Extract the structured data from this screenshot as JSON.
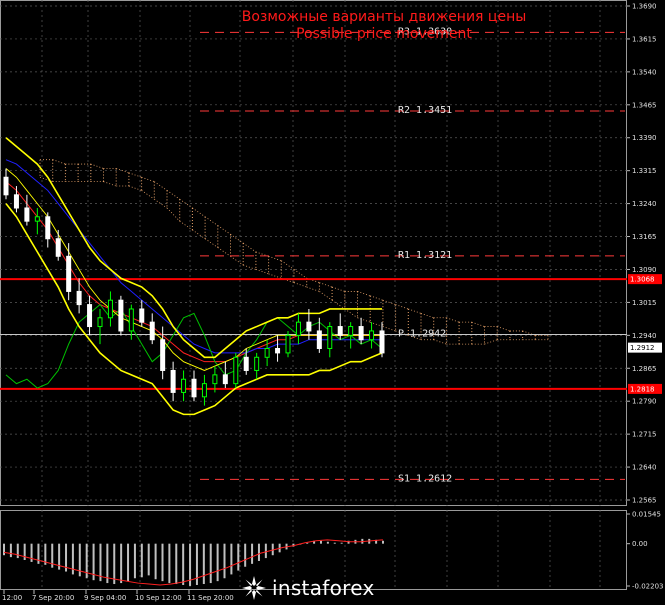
{
  "chart_data": [
    {
      "type": "candlestick",
      "title": "Возможные варианты движения цены",
      "subtitle": "Possible price movement",
      "ylim": [
        1.2565,
        1.369
      ],
      "y_ticks": [
        "1.3690",
        "1.3615",
        "1.3540",
        "1.3465",
        "1.3390",
        "1.3315",
        "1.3240",
        "1.3165",
        "1.3090",
        "1.3015",
        "1.2940",
        "1.2865",
        "1.2790",
        "1.2715",
        "1.2640",
        "1.2565"
      ],
      "x_ticks": [
        "12:00",
        "7 Sep 20:00",
        "9 Sep 04:00",
        "10 Sep 12:00",
        "11 Sep 20:00"
      ],
      "pivots": [
        {
          "label": "R3",
          "value": 1.363
        },
        {
          "label": "R2",
          "value": 1.3451
        },
        {
          "label": "R1",
          "value": 1.3121
        },
        {
          "label": "P",
          "value": 1.2942
        },
        {
          "label": "S1",
          "value": 1.2612
        }
      ],
      "horizontal_levels": [
        {
          "value": 1.3068,
          "label": "1.3068",
          "color": "#ff0000"
        },
        {
          "value": 1.2818,
          "label": "1.2818",
          "color": "#ff0000"
        },
        {
          "value": 1.2942,
          "label": "",
          "color": "#c8c8c8"
        }
      ],
      "current_price": {
        "value": 1.2912,
        "label": "1.2912"
      },
      "candles": [
        [
          1.33,
          1.332,
          1.325,
          1.326
        ],
        [
          1.326,
          1.328,
          1.322,
          1.323
        ],
        [
          1.323,
          1.326,
          1.319,
          1.32
        ],
        [
          1.32,
          1.323,
          1.317,
          1.321
        ],
        [
          1.321,
          1.322,
          1.314,
          1.316
        ],
        [
          1.316,
          1.318,
          1.311,
          1.312
        ],
        [
          1.312,
          1.315,
          1.302,
          1.304
        ],
        [
          1.304,
          1.307,
          1.299,
          1.301
        ],
        [
          1.301,
          1.303,
          1.294,
          1.296
        ],
        [
          1.296,
          1.3,
          1.292,
          1.298
        ],
        [
          1.298,
          1.304,
          1.296,
          1.302
        ],
        [
          1.302,
          1.303,
          1.294,
          1.295
        ],
        [
          1.295,
          1.301,
          1.293,
          1.3
        ],
        [
          1.3,
          1.302,
          1.296,
          1.297
        ],
        [
          1.297,
          1.299,
          1.292,
          1.293
        ],
        [
          1.293,
          1.296,
          1.284,
          1.286
        ],
        [
          1.286,
          1.288,
          1.279,
          1.281
        ],
        [
          1.281,
          1.286,
          1.279,
          1.284
        ],
        [
          1.284,
          1.286,
          1.279,
          1.28
        ],
        [
          1.28,
          1.285,
          1.278,
          1.283
        ],
        [
          1.283,
          1.287,
          1.281,
          1.285
        ],
        [
          1.285,
          1.288,
          1.282,
          1.283
        ],
        [
          1.283,
          1.29,
          1.282,
          1.289
        ],
        [
          1.289,
          1.291,
          1.285,
          1.286
        ],
        [
          1.286,
          1.29,
          1.284,
          1.289
        ],
        [
          1.289,
          1.293,
          1.287,
          1.291
        ],
        [
          1.291,
          1.294,
          1.288,
          1.29
        ],
        [
          1.29,
          1.295,
          1.289,
          1.294
        ],
        [
          1.294,
          1.299,
          1.292,
          1.297
        ],
        [
          1.297,
          1.3,
          1.293,
          1.295
        ],
        [
          1.295,
          1.298,
          1.29,
          1.291
        ],
        [
          1.291,
          1.297,
          1.289,
          1.296
        ],
        [
          1.296,
          1.299,
          1.293,
          1.294
        ],
        [
          1.294,
          1.297,
          1.291,
          1.296
        ],
        [
          1.296,
          1.298,
          1.292,
          1.293
        ],
        [
          1.293,
          1.297,
          1.291,
          1.295
        ],
        [
          1.295,
          1.297,
          1.289,
          1.29
        ]
      ],
      "bollinger_bands": {
        "color": "#ffff00",
        "upper": [
          1.339,
          1.337,
          1.335,
          1.333,
          1.33,
          1.326,
          1.322,
          1.318,
          1.314,
          1.311,
          1.309,
          1.307,
          1.306,
          1.305,
          1.303,
          1.3,
          1.296,
          1.293,
          1.291,
          1.289,
          1.289,
          1.291,
          1.293,
          1.295,
          1.296,
          1.297,
          1.298,
          1.298,
          1.299,
          1.299,
          1.299,
          1.3,
          1.3,
          1.3,
          1.3,
          1.3,
          1.3
        ],
        "middle": [
          1.332,
          1.33,
          1.327,
          1.324,
          1.321,
          1.317,
          1.313,
          1.309,
          1.305,
          1.302,
          1.3,
          1.298,
          1.297,
          1.296,
          1.295,
          1.293,
          1.29,
          1.288,
          1.287,
          1.286,
          1.287,
          1.288,
          1.289,
          1.291,
          1.292,
          1.293,
          1.294,
          1.294,
          1.294,
          1.294,
          1.294,
          1.294,
          1.294,
          1.294,
          1.294,
          1.294,
          1.294
        ],
        "lower": [
          1.324,
          1.321,
          1.317,
          1.313,
          1.309,
          1.305,
          1.3,
          1.296,
          1.293,
          1.29,
          1.288,
          1.286,
          1.285,
          1.284,
          1.283,
          1.28,
          1.277,
          1.276,
          1.276,
          1.277,
          1.278,
          1.28,
          1.282,
          1.283,
          1.284,
          1.285,
          1.285,
          1.285,
          1.285,
          1.285,
          1.286,
          1.286,
          1.287,
          1.288,
          1.288,
          1.289,
          1.29
        ]
      },
      "ichimoku_cloud": {
        "color": "#e8a36a",
        "top": [
          1.334,
          1.334,
          1.333,
          1.333,
          1.333,
          1.332,
          1.332,
          1.331,
          1.33,
          1.329,
          1.327,
          1.325,
          1.323,
          1.321,
          1.319,
          1.317,
          1.315,
          1.313,
          1.312,
          1.311,
          1.309,
          1.307,
          1.306,
          1.305,
          1.304,
          1.304,
          1.303,
          1.302,
          1.301,
          1.3,
          1.299,
          1.298,
          1.298,
          1.297,
          1.297,
          1.296,
          1.296,
          1.295,
          1.295,
          1.294,
          1.294
        ],
        "bottom": [
          1.33,
          1.329,
          1.329,
          1.329,
          1.329,
          1.329,
          1.328,
          1.328,
          1.327,
          1.325,
          1.323,
          1.32,
          1.318,
          1.316,
          1.314,
          1.312,
          1.31,
          1.309,
          1.308,
          1.307,
          1.306,
          1.305,
          1.304,
          1.302,
          1.3,
          1.298,
          1.297,
          1.296,
          1.295,
          1.294,
          1.293,
          1.293,
          1.292,
          1.292,
          1.292,
          1.292,
          1.293,
          1.293,
          1.293,
          1.293,
          1.293
        ]
      },
      "moving_averages": [
        {
          "color": "#ff2020",
          "values": [
            1.329,
            1.327,
            1.324,
            1.321,
            1.318,
            1.314,
            1.31,
            1.306,
            1.303,
            1.301,
            1.3,
            1.299,
            1.298,
            1.297,
            1.296,
            1.294,
            1.292,
            1.29,
            1.289,
            1.288,
            1.288,
            1.288,
            1.289,
            1.29,
            1.291,
            1.292,
            1.293,
            1.293,
            1.294,
            1.294,
            1.294,
            1.294,
            1.294,
            1.294,
            1.294,
            1.294,
            1.294
          ]
        },
        {
          "color": "#2020ff",
          "values": [
            1.334,
            1.333,
            1.331,
            1.329,
            1.327,
            1.324,
            1.321,
            1.318,
            1.315,
            1.312,
            1.309,
            1.306,
            1.304,
            1.302,
            1.3,
            1.298,
            1.296,
            1.294,
            1.292,
            1.291,
            1.29,
            1.29,
            1.29,
            1.29,
            1.291,
            1.291,
            1.292,
            1.292,
            1.292,
            1.293,
            1.293,
            1.293,
            1.293,
            1.293,
            1.293,
            1.293,
            1.293
          ]
        },
        {
          "color": "#00c000",
          "values": [
            1.285,
            1.283,
            1.284,
            1.282,
            1.283,
            1.286,
            1.292,
            1.297,
            1.299,
            1.301,
            1.298,
            1.3,
            1.296,
            1.292,
            1.288,
            1.29,
            1.294,
            1.298,
            1.299,
            1.294,
            1.288,
            1.285,
            1.286,
            1.29,
            1.293,
            1.297,
            1.298,
            1.296,
            1.294,
            1.296,
            1.297,
            1.295,
            1.293,
            1.294,
            1.292,
            1.293,
            1.291
          ]
        }
      ]
    },
    {
      "type": "bar",
      "ylim": [
        -0.02203,
        0.01545
      ],
      "y_ticks": [
        "0.01545",
        "0.00",
        "-0.02203"
      ],
      "values": [
        -0.006,
        -0.007,
        -0.0075,
        -0.0085,
        -0.0095,
        -0.0105,
        -0.011,
        -0.0125,
        -0.0135,
        -0.0145,
        -0.016,
        -0.017,
        -0.018,
        -0.019,
        -0.0195,
        -0.0205,
        -0.021,
        -0.0205,
        -0.0195,
        -0.018,
        -0.0175,
        -0.0165,
        -0.0185,
        -0.0195,
        -0.0205,
        -0.021,
        -0.0215,
        -0.022,
        -0.0215,
        -0.021,
        -0.0205,
        -0.0195,
        -0.018,
        -0.016,
        -0.014,
        -0.012,
        -0.0105,
        -0.009,
        -0.0075,
        -0.006,
        -0.0045,
        -0.003,
        -0.0015,
        -0.0005,
        0.0005,
        0.0015,
        0.0015,
        0.001,
        0.0005,
        0.0005,
        0.0015,
        0.002,
        0.0025,
        0.0025,
        0.002,
        0.0015
      ],
      "signal": [
        -0.0045,
        -0.0055,
        -0.007,
        -0.0085,
        -0.01,
        -0.0115,
        -0.013,
        -0.0145,
        -0.016,
        -0.0175,
        -0.0185,
        -0.0195,
        -0.0205,
        -0.021,
        -0.0215,
        -0.021,
        -0.02,
        -0.0185,
        -0.0165,
        -0.0145,
        -0.0125,
        -0.01,
        -0.0075,
        -0.005,
        -0.0035,
        -0.002,
        -0.001,
        0.0005,
        0.0015,
        0.002,
        0.0015,
        0.001,
        0.001,
        0.0015,
        0.002
      ],
      "bar_color": "#c0c0c0",
      "signal_color": "#ff2020"
    }
  ],
  "colors": {
    "background": "#000000",
    "grid": "#5a5a5a",
    "axis_text": "#e0e0e0",
    "bull_candle": "#00ff00",
    "bear_candle": "#ffffff",
    "pivot_line": "#ff3a3a",
    "title": "#ff1a1a"
  },
  "logo": {
    "text": "instaforex",
    "icon": "instaforex-star-icon"
  }
}
